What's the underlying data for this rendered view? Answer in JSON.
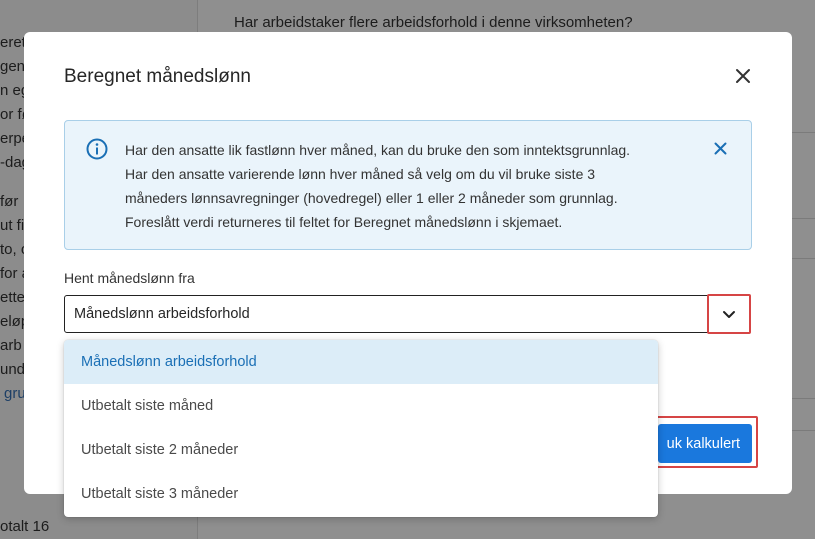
{
  "background": {
    "question": "Har arbeidstaker flere arbeidsforhold i denne virksomheten?",
    "left_fragments": [
      "eret",
      "gen",
      "n eg",
      "or fø",
      "erpe",
      "-dag",
      "før",
      "ut fi",
      "to, o",
      "for a",
      "ette",
      "eløp",
      "arb",
      "und",
      "gru",
      "otalt 16"
    ]
  },
  "modal": {
    "title": "Beregnet månedslønn",
    "info_lines": [
      "Har den ansatte lik fastlønn hver måned, kan du bruke den som inntektsgrunnlag.",
      "Har den ansatte varierende lønn hver måned så velg om du vil bruke siste 3",
      "måneders lønnsavregninger (hovedregel) eller 1 eller 2 måneder som grunnlag.",
      "Foreslått verdi returneres til feltet for Beregnet månedslønn i skjemaet."
    ],
    "field_label": "Hent månedslønn fra",
    "selected_value": "Månedslønn arbeidsforhold",
    "options": [
      "Månedslønn arbeidsforhold",
      "Utbetalt siste måned",
      "Utbetalt siste 2 måneder",
      "Utbetalt siste 3 måneder"
    ],
    "use_button_label": "uk kalkulert"
  },
  "colors": {
    "primary": "#1a78dd",
    "info_bg": "#eaf4fb",
    "highlight_border": "#d64545",
    "selected_option_bg": "#dcedf8"
  }
}
